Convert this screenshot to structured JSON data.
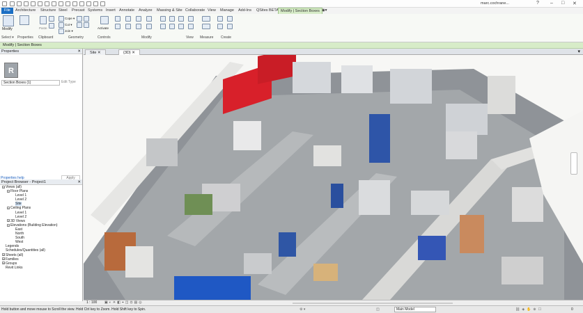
{
  "qat": {
    "user": "marc.cochrane..."
  },
  "tabs": [
    "File",
    "Architecture",
    "Structure",
    "Steel",
    "Precast",
    "Systems",
    "Insert",
    "Annotate",
    "Analyze",
    "Massing & Site",
    "Collaborate",
    "View",
    "Manage",
    "Add-Ins",
    "QSites BETA",
    "Modify | Section Boxes"
  ],
  "ribbon": {
    "modify_label": "Modify",
    "select_label": "Select ▾",
    "panels": [
      "Properties",
      "Clipboard",
      "Geometry",
      "Controls",
      "Modify",
      "View",
      "Measure",
      "Create"
    ],
    "small": {
      "cope": "Cope ▾",
      "cut": "Cut ▾",
      "join": "Join ▾",
      "paste": "Paste",
      "activate": "Activate"
    }
  },
  "context_bar": "Modify | Section Boxes",
  "properties": {
    "header": "Properties",
    "type_selector": "Section Boxes (1)",
    "edit_type": "Edit Type",
    "help_link": "Properties help",
    "apply": "Apply"
  },
  "browser": {
    "header": "Project Browser - Project1",
    "items": [
      {
        "indent": 0,
        "box": "−",
        "text": "Views (all)"
      },
      {
        "indent": 1,
        "box": "−",
        "text": "Floor Plans"
      },
      {
        "indent": 2,
        "box": "",
        "text": "Level 1"
      },
      {
        "indent": 2,
        "box": "",
        "text": "Level 2"
      },
      {
        "indent": 2,
        "box": "",
        "text": "Site"
      },
      {
        "indent": 1,
        "box": "−",
        "text": "Ceiling Plans"
      },
      {
        "indent": 2,
        "box": "",
        "text": "Level 1"
      },
      {
        "indent": 2,
        "box": "",
        "text": "Level 2"
      },
      {
        "indent": 1,
        "box": "+",
        "text": "3D Views"
      },
      {
        "indent": 1,
        "box": "−",
        "text": "Elevations (Building Elevation)"
      },
      {
        "indent": 2,
        "box": "",
        "text": "East"
      },
      {
        "indent": 2,
        "box": "",
        "text": "North"
      },
      {
        "indent": 2,
        "box": "",
        "text": "South"
      },
      {
        "indent": 2,
        "box": "",
        "text": "West"
      },
      {
        "indent": 0,
        "box": "",
        "text": "Legends"
      },
      {
        "indent": 0,
        "box": "",
        "text": "Schedules/Quantities (all)"
      },
      {
        "indent": 0,
        "box": "+",
        "text": "Sheets (all)"
      },
      {
        "indent": 0,
        "box": "+",
        "text": "Families"
      },
      {
        "indent": 0,
        "box": "+",
        "text": "Groups"
      },
      {
        "indent": 0,
        "box": "",
        "text": "Revit Links"
      }
    ]
  },
  "view_tabs": [
    {
      "label": "Site"
    },
    {
      "label": "{3D}"
    }
  ],
  "view_bar": {
    "scale": "1 : 100"
  },
  "status": {
    "message": "Hold button and move mouse to Scroll the view. Hold Ctrl key to Zoom. Hold Shift key to Spin.",
    "model": "Main Model",
    "right": "0"
  }
}
